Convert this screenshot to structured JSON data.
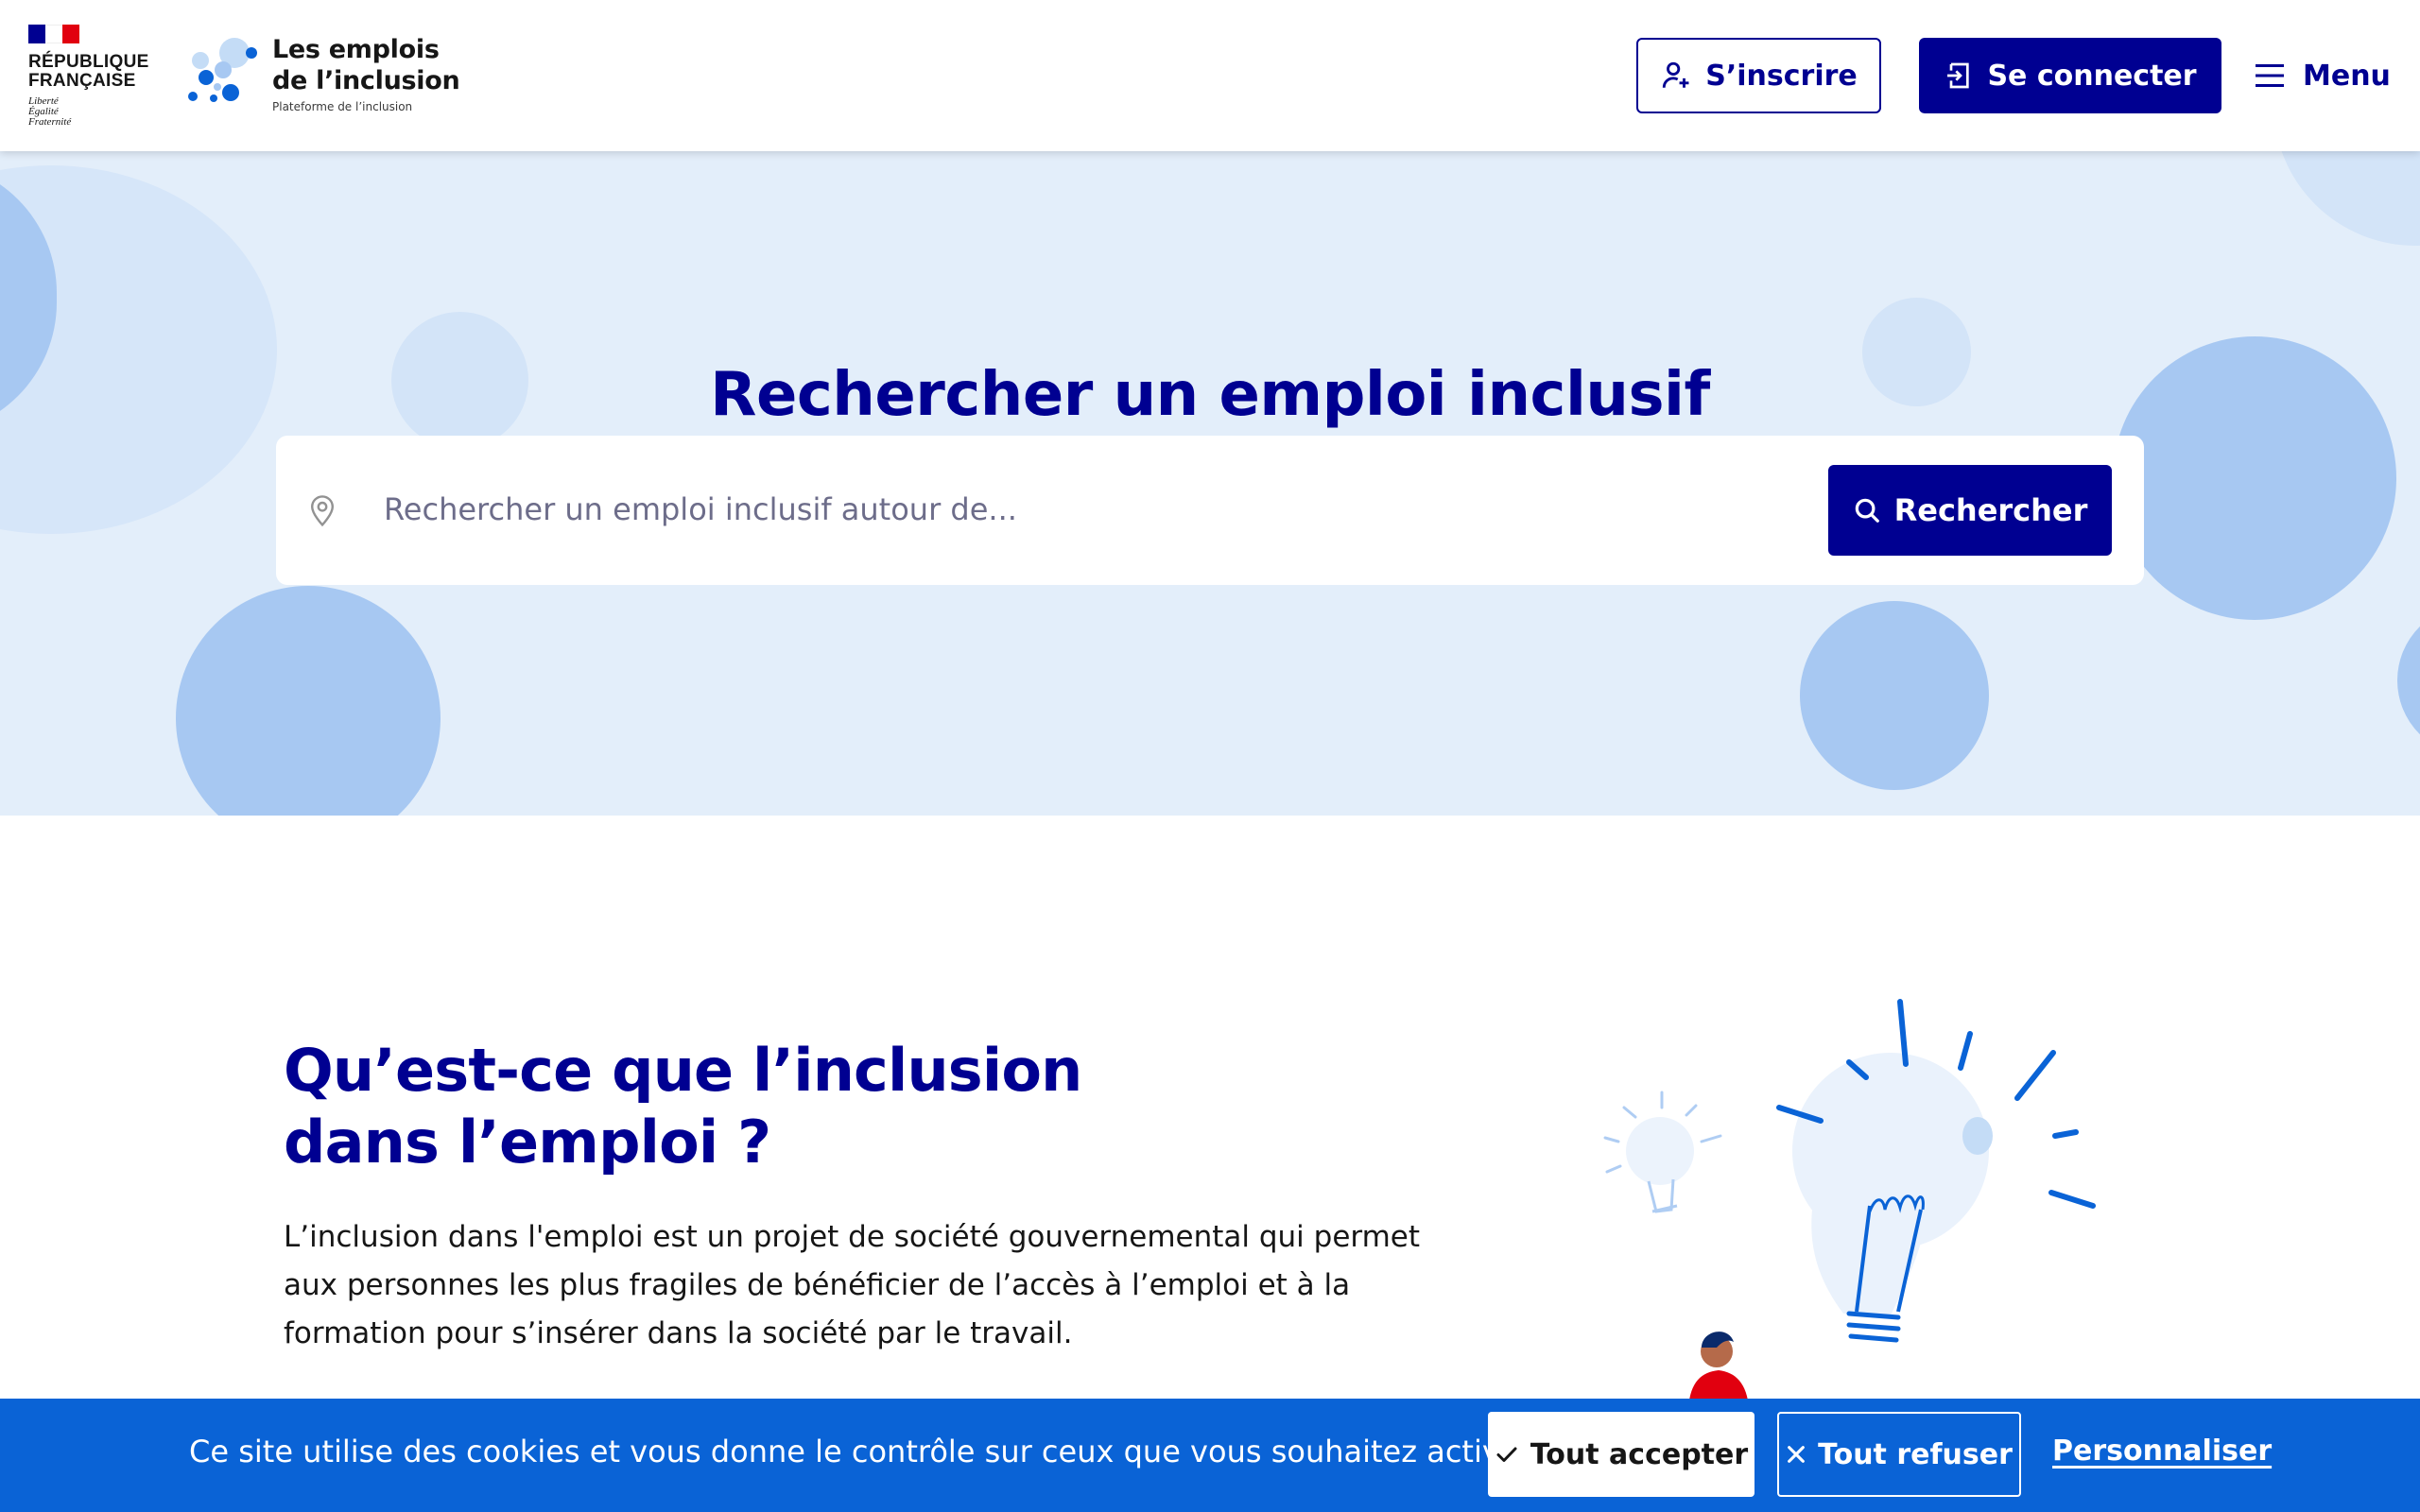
{
  "header": {
    "republique_line1": "RÉPUBLIQUE",
    "republique_line2": "FRANÇAISE",
    "motto": [
      "Liberté",
      "Égalité",
      "Fraternité"
    ],
    "product_title_line1": "Les emplois",
    "product_title_line2": "de l’inclusion",
    "product_subtitle": "Plateforme de l’inclusion",
    "signup_label": "S’inscrire",
    "login_label": "Se connecter",
    "menu_label": "Menu"
  },
  "hero": {
    "title": "Rechercher un emploi inclusif",
    "search_placeholder": "Rechercher un emploi inclusif autour de...",
    "search_button_label": "Rechercher"
  },
  "info": {
    "title_line1": "Qu’est-ce que l’inclusion",
    "title_line2": "dans l’emploi ?",
    "text_line1": "L’inclusion dans l'emploi est un projet de société gouvernemental qui permet",
    "text_line2": "aux personnes les plus fragiles de bénéficier de l’accès à l’emploi et à la",
    "text_line3": "formation pour s’insérer dans la société par le travail."
  },
  "cookie_banner": {
    "message": "Ce site utilise des cookies et vous donne le contrôle sur ceux que vous souhaitez activer",
    "accept_label": "Tout accepter",
    "refuse_label": "Tout refuser",
    "customize_label": "Personnaliser"
  },
  "colors": {
    "primary": "#000091",
    "hero_background": "#e3eefa",
    "bubble": "#a7c8f2",
    "cookie_background": "#0a63d6",
    "flag_blue": "#000091",
    "flag_red": "#e1000f"
  },
  "icons": {
    "signup": "user-add-icon",
    "login": "login-icon",
    "menu": "hamburger-icon",
    "location": "map-pin-icon",
    "search": "search-icon",
    "accept": "check-icon",
    "refuse": "close-icon"
  }
}
